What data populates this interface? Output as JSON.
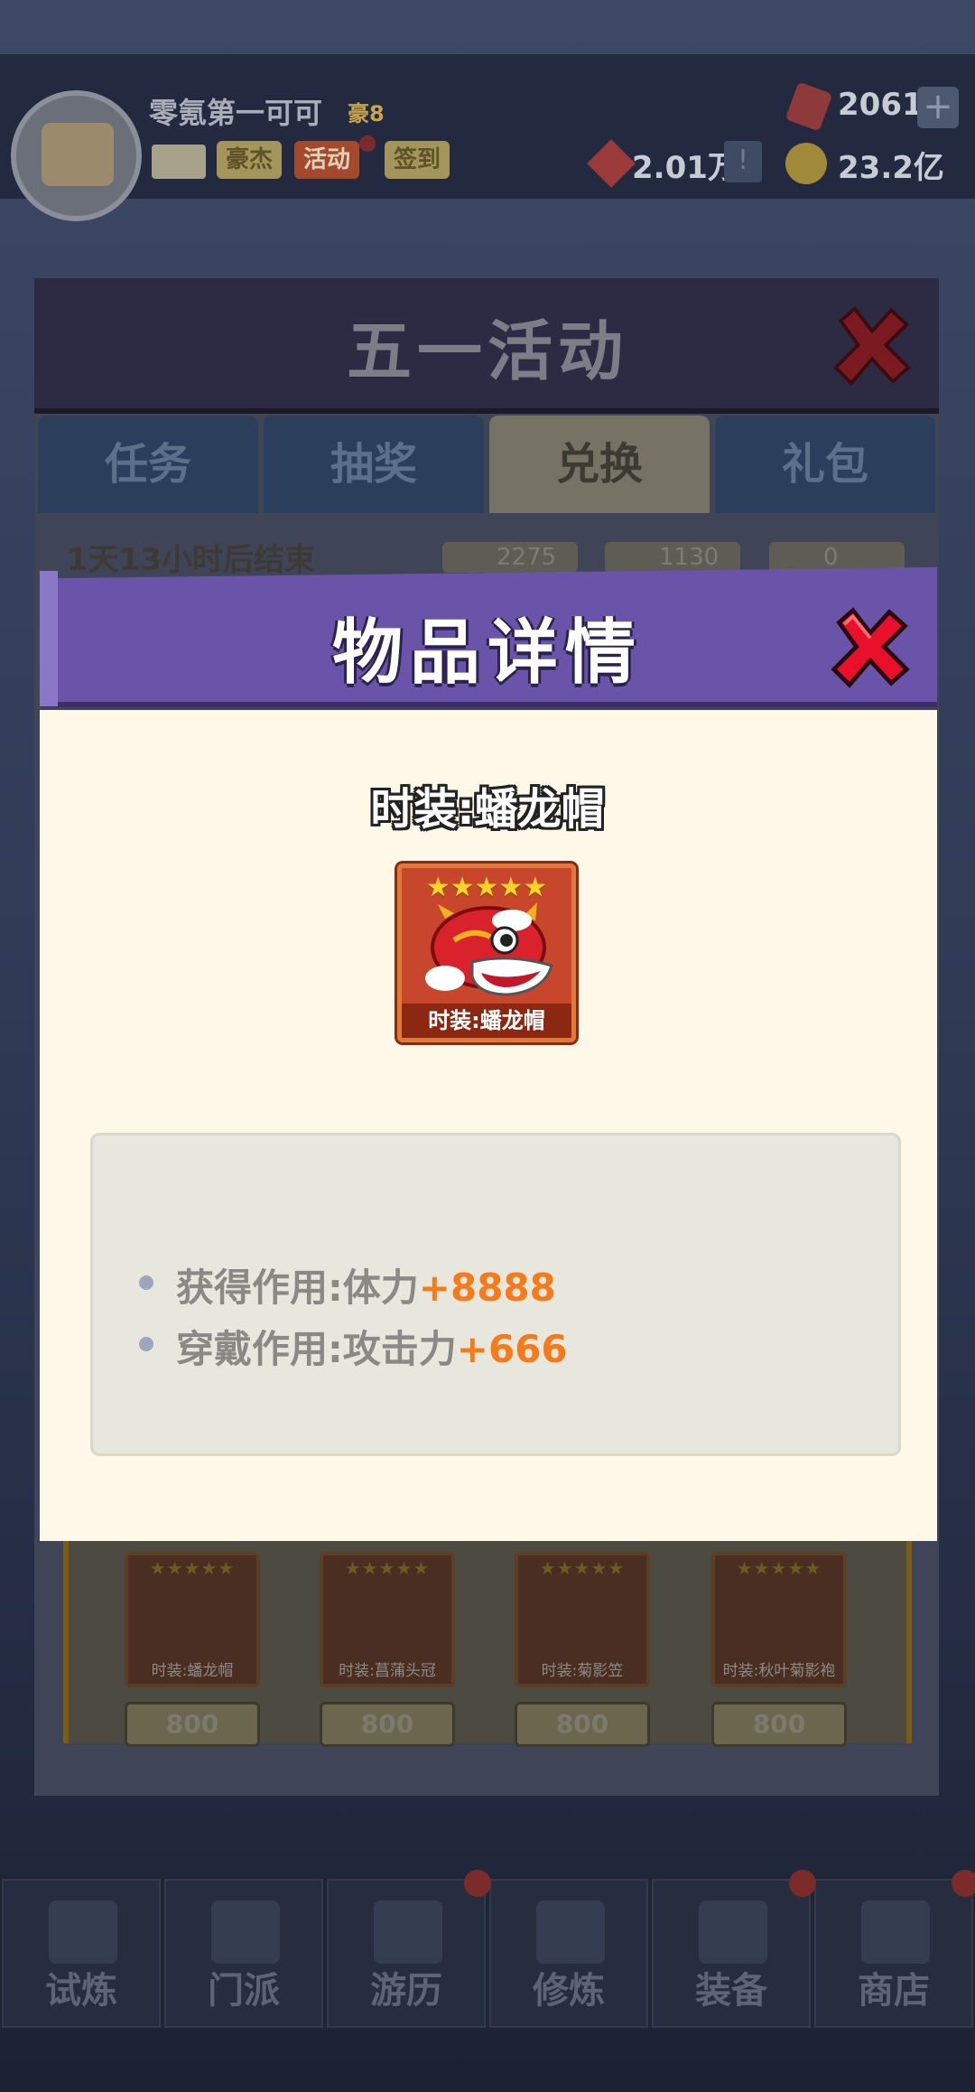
{
  "header": {
    "player_name": "零氪第一可可",
    "vip_label": "豪8",
    "buttons": [
      "豪杰",
      "活动",
      "签到"
    ],
    "gems": "2061",
    "power": "2.01万",
    "coins": "23.2亿"
  },
  "activity": {
    "title": "五一活动",
    "tabs": [
      "任务",
      "抽奖",
      "兑换",
      "礼包"
    ],
    "active_tab": "兑换",
    "timer": "1天13小时后结束",
    "currencies": [
      "2275",
      "1130",
      "0"
    ],
    "goods": [
      {
        "name": "时装:蟠龙帽",
        "price": "800"
      },
      {
        "name": "时装:菖蒲头冠",
        "price": "800"
      },
      {
        "name": "时装:菊影笠",
        "price": "800"
      },
      {
        "name": "时装:秋叶菊影袍",
        "price": "800"
      }
    ]
  },
  "bottom_nav": [
    "试炼",
    "门派",
    "游历",
    "修炼",
    "装备",
    "商店"
  ],
  "dialog": {
    "title": "物品详情",
    "item_name": "时装:蟠龙帽",
    "card_stars": "★★★★★",
    "card_label": "时装:蟠龙帽",
    "effects": [
      {
        "label": "获得作用:体力",
        "value": "+8888"
      },
      {
        "label": "穿戴作用:攻击力",
        "value": "+666"
      }
    ]
  },
  "colors": {
    "dialog_header": "#6a54a9",
    "dialog_body": "#fdf8e8",
    "effect_value": "#f57a1a",
    "close_icon": "#e8102a"
  }
}
